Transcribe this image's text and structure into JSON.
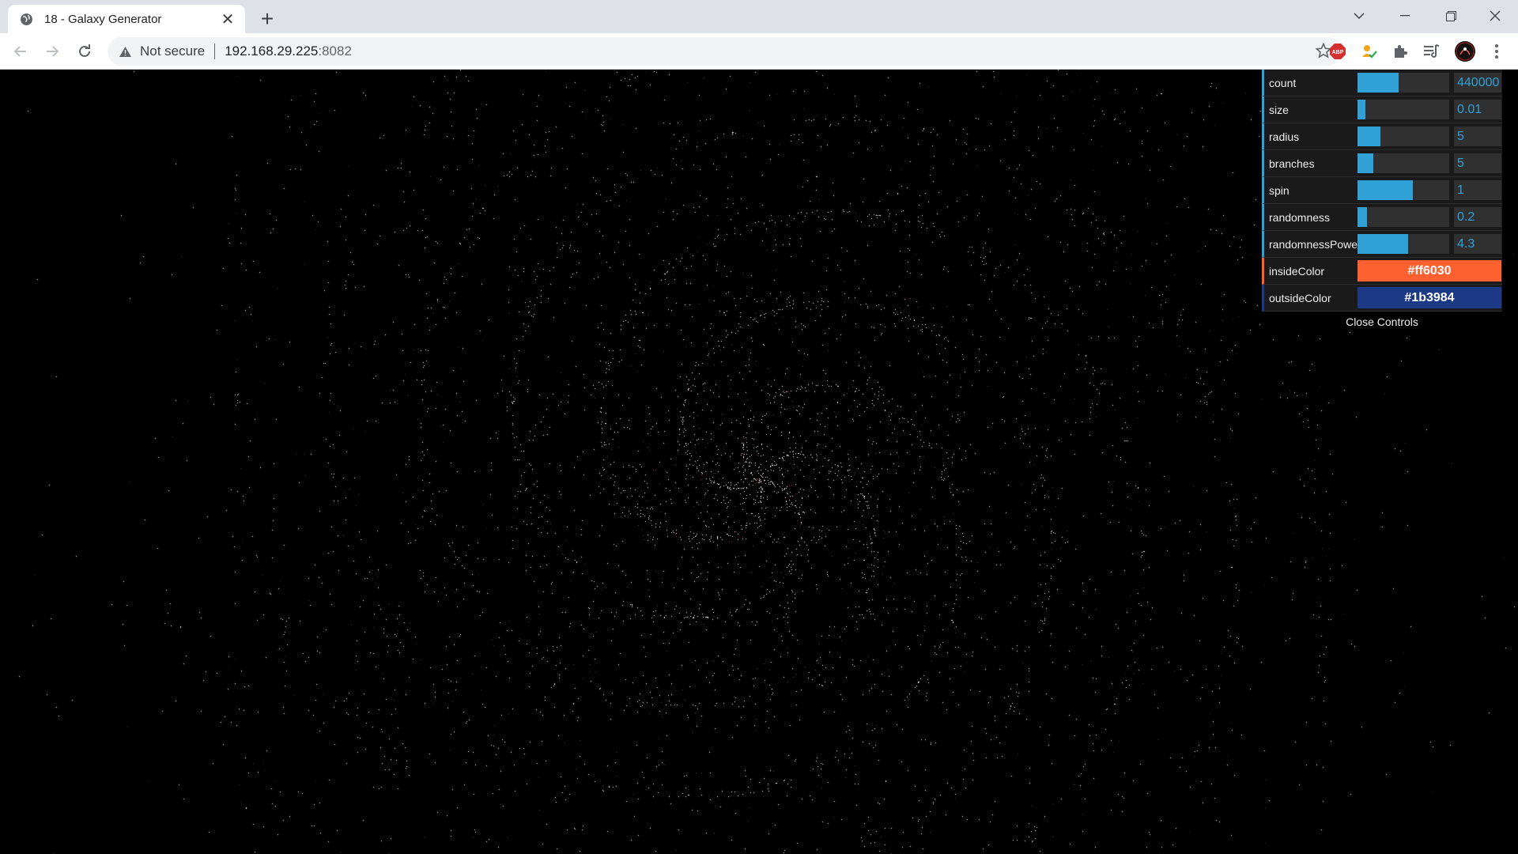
{
  "browser": {
    "tab_title": "18 - Galaxy Generator",
    "security_label": "Not secure",
    "url_host": "192.168.29.225",
    "url_port": ":8082",
    "icons": [
      "globe-icon",
      "close-icon",
      "plus-icon",
      "chevron-down-icon",
      "minimize-icon",
      "restore-icon",
      "close-window-icon",
      "back-arrow-icon",
      "forward-arrow-icon",
      "reload-icon",
      "warning-icon",
      "star-icon",
      "adblock-icon",
      "extension-icon",
      "puzzle-icon",
      "media-icon",
      "profile-avatar-icon",
      "kebab-menu-icon"
    ]
  },
  "scene": {
    "background": "#000000",
    "inside_color": "#ff6030",
    "outside_color": "#1b3984",
    "branches": 5
  },
  "controls": {
    "count": {
      "label": "count",
      "value": "440000",
      "fraction": 0.45
    },
    "size": {
      "label": "size",
      "value": "0.01",
      "fraction": 0.09
    },
    "radius": {
      "label": "radius",
      "value": "5",
      "fraction": 0.25
    },
    "branches": {
      "label": "branches",
      "value": "5",
      "fraction": 0.17
    },
    "spin": {
      "label": "spin",
      "value": "1",
      "fraction": 0.6
    },
    "randomness": {
      "label": "randomness",
      "value": "0.2",
      "fraction": 0.1
    },
    "randomnessPower": {
      "label": "randomnessPowe",
      "value": "4.3",
      "fraction": 0.55
    },
    "insideColor": {
      "label": "insideColor",
      "value": "#ff6030"
    },
    "outsideColor": {
      "label": "outsideColor",
      "value": "#1b3984"
    },
    "close_label": "Close Controls"
  }
}
